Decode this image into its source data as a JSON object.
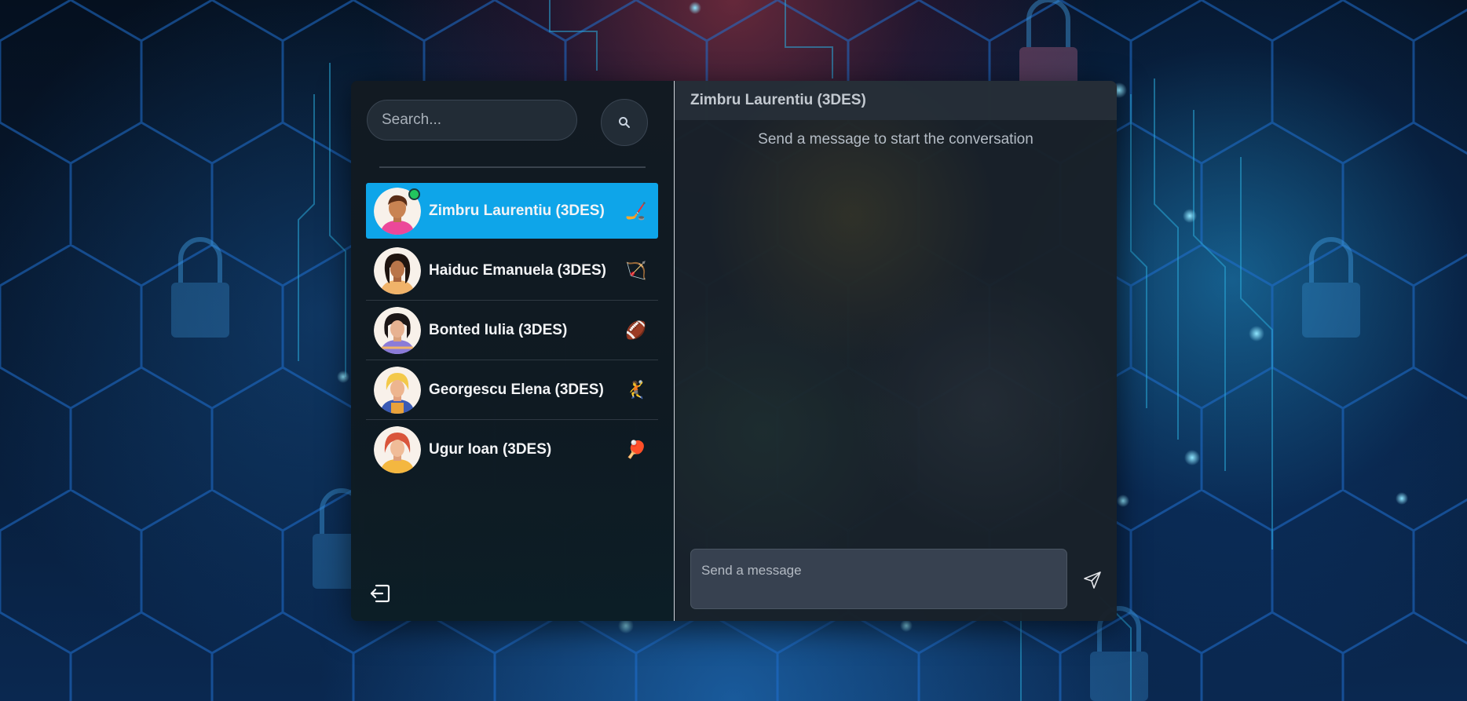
{
  "background": {
    "accent": "#1e90ff",
    "description_icons": [
      "padlock-icon",
      "circuit-pattern"
    ]
  },
  "sidebar": {
    "search": {
      "placeholder": "Search...",
      "button_icon": "search-icon"
    },
    "contacts": [
      {
        "name": "Zimbru Laurentiu (3DES)",
        "emoji": "🏒",
        "online": true,
        "active": true,
        "avatar_color": "#ec4899"
      },
      {
        "name": "Haiduc Emanuela (3DES)",
        "emoji": "🏹",
        "online": false,
        "active": false,
        "avatar_color": "#f0b36a"
      },
      {
        "name": "Bonted Iulia (3DES)",
        "emoji": "🏈",
        "online": false,
        "active": false,
        "avatar_color": "#8b7bd8"
      },
      {
        "name": "Georgescu Elena (3DES)",
        "emoji": "🤾",
        "online": false,
        "active": false,
        "avatar_color": "#3b5bb5"
      },
      {
        "name": "Ugur Ioan (3DES)",
        "emoji": "🏓",
        "online": false,
        "active": false,
        "avatar_color": "#f4b740"
      }
    ],
    "logout_icon": "logout-icon"
  },
  "chat": {
    "title": "Zimbru Laurentiu (3DES)",
    "empty_message": "Send a message to start the conversation",
    "composer_placeholder": "Send a message",
    "send_icon": "send-icon"
  },
  "colors": {
    "active_contact": "#0ea5e9",
    "online_dot": "#22c55e"
  }
}
